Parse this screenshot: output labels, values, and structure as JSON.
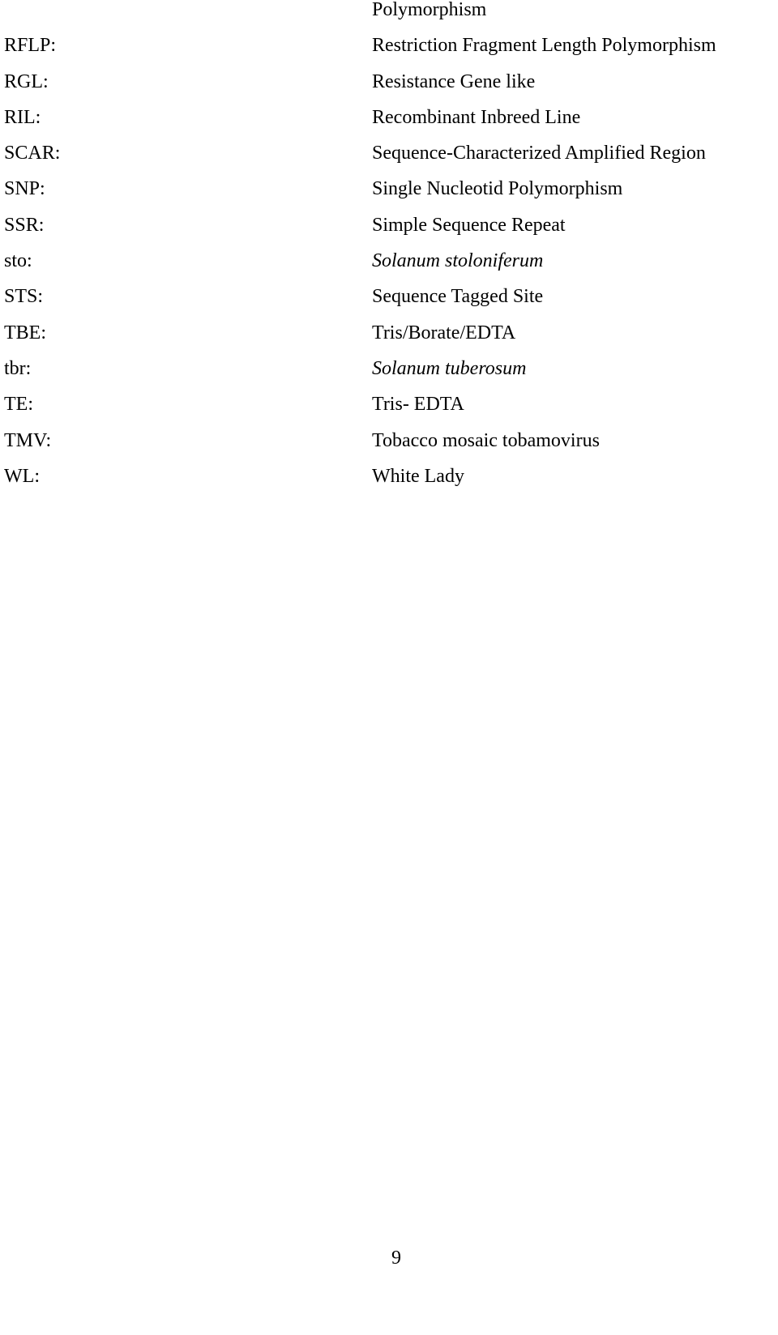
{
  "abbreviations": [
    {
      "abbr": "",
      "definition": "Polymorphism",
      "italic": false
    },
    {
      "abbr": "RFLP:",
      "definition": "Restriction Fragment Length Polymorphism",
      "italic": false
    },
    {
      "abbr": "RGL:",
      "definition": "Resistance Gene like",
      "italic": false
    },
    {
      "abbr": "RIL:",
      "definition": "Recombinant Inbreed Line",
      "italic": false
    },
    {
      "abbr": "SCAR:",
      "definition": "Sequence-Characterized Amplified Region",
      "italic": false
    },
    {
      "abbr": "SNP:",
      "definition": "Single Nucleotid Polymorphism",
      "italic": false
    },
    {
      "abbr": "SSR:",
      "definition": "Simple Sequence Repeat",
      "italic": false
    },
    {
      "abbr": "sto:",
      "definition": "Solanum stoloniferum",
      "italic": true
    },
    {
      "abbr": "STS:",
      "definition": "Sequence Tagged Site",
      "italic": false
    },
    {
      "abbr": "TBE:",
      "definition": "Tris/Borate/EDTA",
      "italic": false
    },
    {
      "abbr": "tbr:",
      "definition": "Solanum tuberosum",
      "italic": true
    },
    {
      "abbr": "TE:",
      "definition": "Tris- EDTA",
      "italic": false
    },
    {
      "abbr": "TMV:",
      "definition": "Tobacco mosaic tobamovirus",
      "italic": false
    },
    {
      "abbr": "WL:",
      "definition": "White Lady",
      "italic": false
    }
  ],
  "page_number": "9"
}
